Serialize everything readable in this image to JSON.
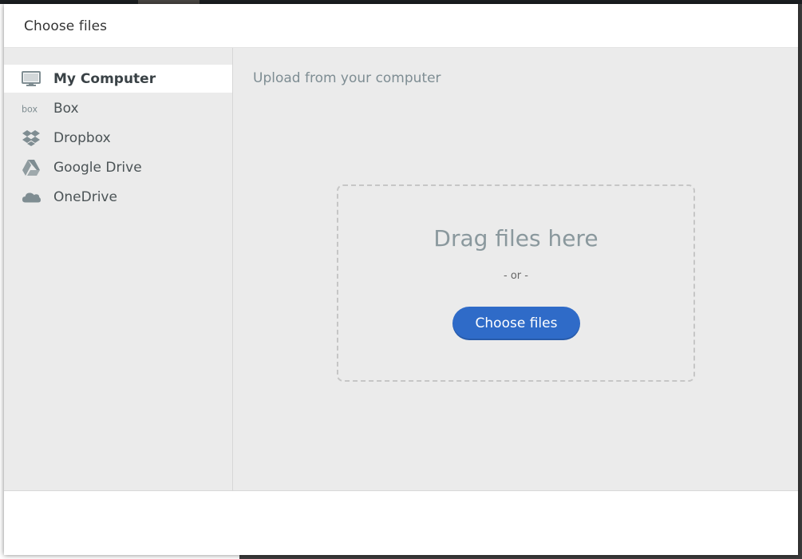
{
  "modal": {
    "title": "Choose files"
  },
  "sidebar": {
    "items": [
      {
        "label": "My Computer",
        "icon": "computer-icon",
        "active": true
      },
      {
        "label": "Box",
        "icon": "box-icon",
        "active": false
      },
      {
        "label": "Dropbox",
        "icon": "dropbox-icon",
        "active": false
      },
      {
        "label": "Google Drive",
        "icon": "google-drive-icon",
        "active": false
      },
      {
        "label": "OneDrive",
        "icon": "onedrive-icon",
        "active": false
      }
    ]
  },
  "main": {
    "heading": "Upload from your computer",
    "drop_zone": {
      "title": "Drag files here",
      "or_text": "- or -",
      "button_label": "Choose files"
    }
  },
  "colors": {
    "accent": "#2f6bc8",
    "panel_bg": "#ebebeb",
    "icon_gray": "#7f8d92"
  }
}
